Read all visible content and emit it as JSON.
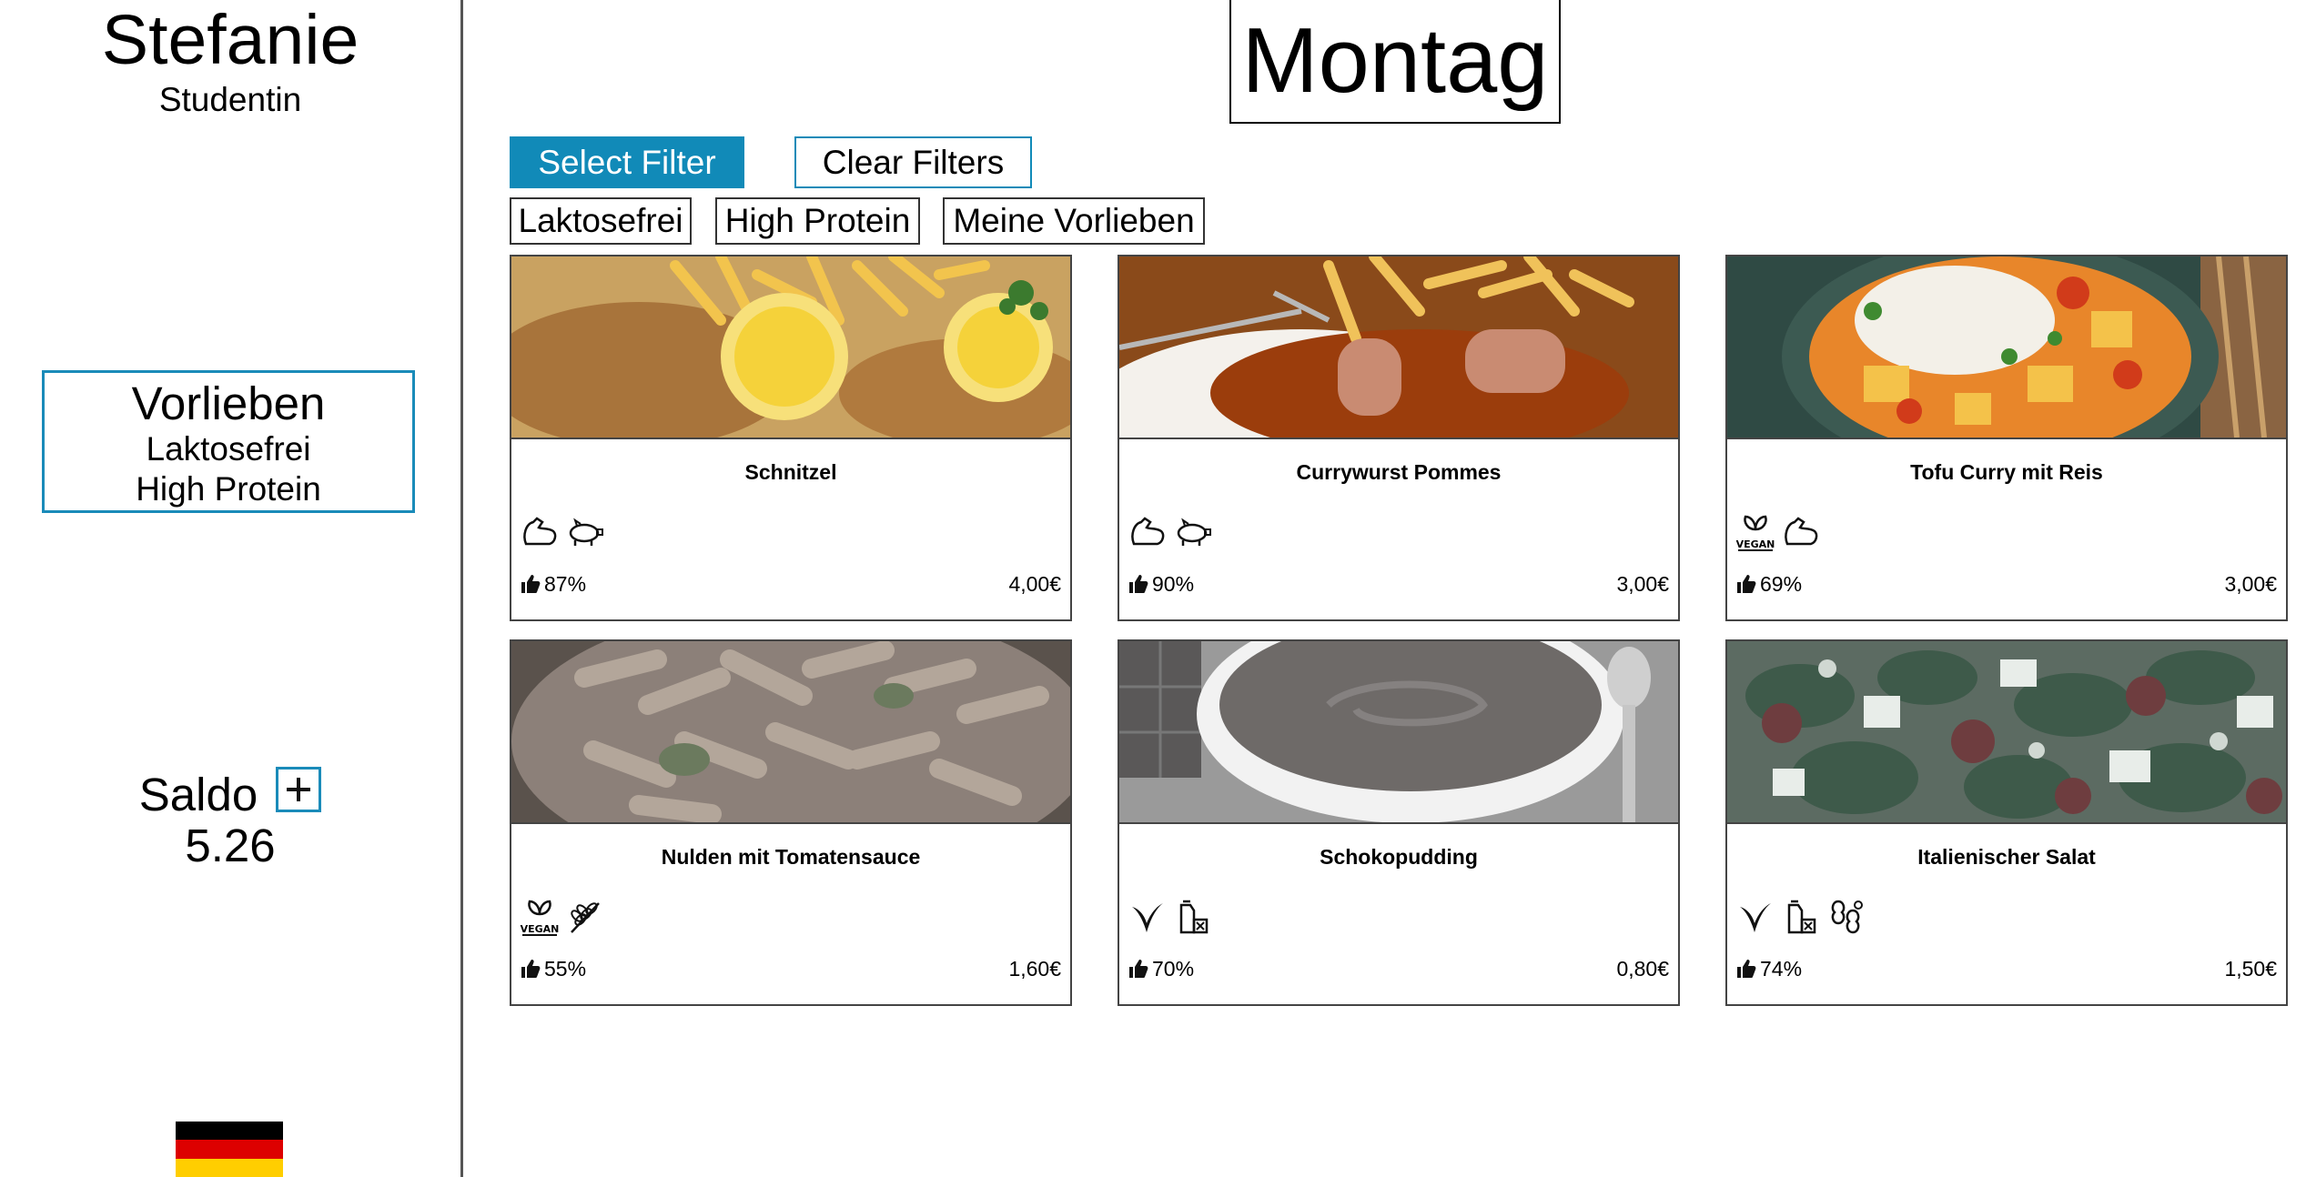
{
  "user": {
    "name": "Stefanie",
    "role": "Studentin"
  },
  "preferences": {
    "title": "Vorlieben",
    "items": [
      "Laktosefrei",
      "High Protein"
    ]
  },
  "balance": {
    "label": "Saldo",
    "value": "5.26"
  },
  "language_flag": "flag-germany-icon",
  "day": "Montag",
  "filter_bar": {
    "select_label": "Select Filter",
    "clear_label": "Clear Filters",
    "chips": [
      "Laktosefrei",
      "High Protein",
      "Meine Vorlieben"
    ]
  },
  "colors": {
    "accent": "#118ab8"
  },
  "meals": [
    {
      "name": "Schnitzel",
      "icons": [
        "high-protein-icon",
        "pork-icon"
      ],
      "rating": "87%",
      "price": "4,00€"
    },
    {
      "name": "Currywurst Pommes",
      "icons": [
        "high-protein-icon",
        "pork-icon"
      ],
      "rating": "90%",
      "price": "3,00€"
    },
    {
      "name": "Tofu Curry mit Reis",
      "icons": [
        "vegan-icon",
        "high-protein-icon"
      ],
      "rating": "69%",
      "price": "3,00€"
    },
    {
      "name": "Nulden mit Tomatensauce",
      "icons": [
        "vegan-icon",
        "gluten-icon"
      ],
      "rating": "55%",
      "price": "1,60€"
    },
    {
      "name": "Schokopudding",
      "icons": [
        "vegetarian-icon",
        "lactose-free-icon"
      ],
      "rating": "70%",
      "price": "0,80€"
    },
    {
      "name": "Italienischer Salat",
      "icons": [
        "vegetarian-icon",
        "lactose-free-icon",
        "nuts-icon"
      ],
      "rating": "74%",
      "price": "1,50€"
    }
  ]
}
